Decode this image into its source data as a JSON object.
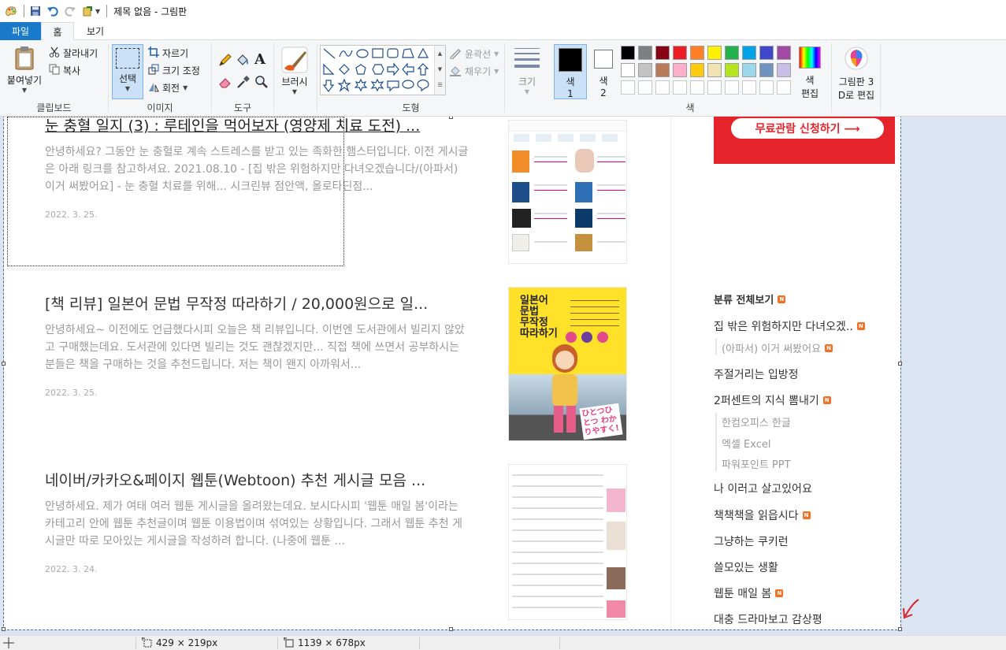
{
  "window": {
    "title": "제목 없음 - 그림판"
  },
  "tabs": {
    "file": "파일",
    "home": "홈",
    "view": "보기"
  },
  "ribbon": {
    "clipboard": {
      "paste": "붙여넣기",
      "cut": "잘라내기",
      "copy": "복사",
      "label": "클립보드"
    },
    "image": {
      "select": "선택",
      "crop": "자르기",
      "resize": "크기 조정",
      "rotate": "회전",
      "label": "이미지"
    },
    "tools": {
      "label": "도구"
    },
    "brush": {
      "label": "브러시"
    },
    "shapes": {
      "outline": "윤곽선",
      "fill": "채우기",
      "label": "도형"
    },
    "size": {
      "label": "크기"
    },
    "colors": {
      "color1_line1": "색",
      "color1_line2": "1",
      "color2_line1": "색",
      "color2_line2": "2",
      "edit_line1": "색",
      "edit_line2": "편집",
      "label": "색"
    },
    "paint3d": {
      "line1": "그림판 3",
      "line2": "D로 편집"
    }
  },
  "palette": {
    "row1": [
      "#000000",
      "#7f7f7f",
      "#880015",
      "#ed1c24",
      "#ff7f27",
      "#fff200",
      "#22b14c",
      "#00a2e8",
      "#3f48cc",
      "#a349a4"
    ],
    "row2": [
      "#ffffff",
      "#c3c3c3",
      "#b97a57",
      "#ffaec9",
      "#ffc90e",
      "#efe4b0",
      "#b5e61d",
      "#99d9ea",
      "#7092be",
      "#c8bfe7"
    ],
    "color1": "#000000",
    "color2": "#ffffff"
  },
  "canvas": {
    "posts": [
      {
        "title": "눈 충혈 일지 (3) : 루테인을 먹어보자 (영양제 치료 도전) ...",
        "excerpt": "안녕하세요? 그동안 눈 충혈로 계속 스트레스를 받고 있는 족화한 햄스터입니다. 이전 게시글은 아래 링크를 참고하셔요. 2021.08.10 - [집 밖은 위험하지만 다녀오겠습니다/(아파서) 이거 써봤어요] - 눈 충혈 치료를 위해... 시크린뷰 점안액, 올로타딘점...",
        "date": "2022. 3. 25."
      },
      {
        "title": "[책 리뷰] 일본어 문법 무작정 따라하기 / 20,000원으로 일...",
        "excerpt": "안녕하세요~ 이전에도 언급했다시피 오늘은 책 리뷰입니다. 이번엔 도서관에서 빌리지 않았고 구매했는데요. 도서관에 있다면 빌리는 것도 괜찮겠지만... 직접 책에 쓰면서 공부하시는 분들은 책을 구매하는 것을 추천드립니다. 저는 책이 왠지 아까워서...",
        "date": "2022. 3. 25."
      },
      {
        "title": "네이버/카카오&페이지 웹툰(Webtoon) 추천 게시글 모음 ...",
        "excerpt": "안녕하세요. 제가 여태 여러 웹툰 게시글을 올려왔는데요. 보시다시피 '웹툰 매일 봄'이라는 카테고리 안에 웹툰 추천글이며 웹툰 이용법이며 섞여있는 상황입니다. 그래서 웹툰 추천 게시글만 따로 모아있는 게시글을 작성하려 합니다. (나중에 웹툰 ...",
        "date": "2022. 3. 24."
      }
    ],
    "book_cover": {
      "title_lines": [
        "일본어",
        "문법",
        "무작정",
        "따라하기"
      ],
      "tagline": "ひとつひとつ わかりやすく!"
    },
    "banner": "무료관람 신청하기 ⟶",
    "sidebar": [
      {
        "text": "분류 전체보기",
        "badge": "N",
        "bold": true
      },
      {
        "text": "집 밖은 위험하지만 다녀오겠..",
        "badge": "N"
      },
      {
        "text": "(아파서) 이거 써봤어요",
        "badge": "N",
        "sub": true
      },
      {
        "text": "주절거리는 입방정",
        "badge": ""
      },
      {
        "text": "2퍼센트의 지식 뽐내기",
        "badge": "N"
      },
      {
        "text": "한컴오피스 한글",
        "badge": "",
        "sub": true
      },
      {
        "text": "엑셀 Excel",
        "badge": "",
        "sub": true
      },
      {
        "text": "파워포인트 PPT",
        "badge": "",
        "sub": true
      },
      {
        "text": "나 이러고 살고있어요",
        "badge": ""
      },
      {
        "text": "책책책을 읽읍시다",
        "badge": "N"
      },
      {
        "text": "그냥하는 쿠키런",
        "badge": ""
      },
      {
        "text": "쓸모있는 생활",
        "badge": ""
      },
      {
        "text": "웹툰 매일 봄",
        "badge": "N"
      },
      {
        "text": "대충 드라마보고 감상평",
        "badge": ""
      }
    ]
  },
  "status": {
    "selection_size": "429 × 219px",
    "canvas_size": "1139 × 678px"
  }
}
